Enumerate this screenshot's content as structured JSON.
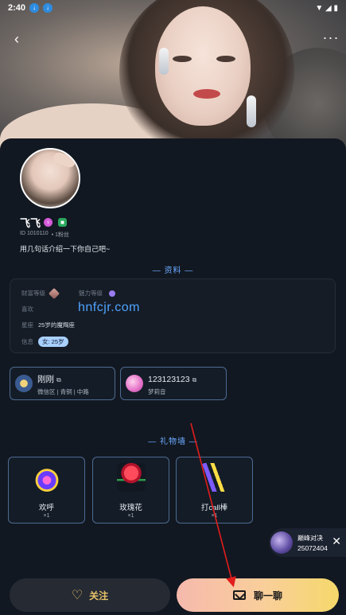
{
  "status_bar": {
    "time": "2:40",
    "badge1": "↓",
    "badge2": "↓",
    "right_icons": "▼ ◢ ▮"
  },
  "nav": {
    "back": "‹",
    "more": "···"
  },
  "profile": {
    "name": "飞飞",
    "gender_icon": "♀",
    "level_badge": "■",
    "id_text": "ID 1010110",
    "fans_text": "• 1粉丝",
    "bio": "用几句话介绍一下你自己吧~"
  },
  "sections": {
    "info": "— 资料 —",
    "gifts": "— 礼物墙 —"
  },
  "info": {
    "wealth_label": "财富等级",
    "charm_label": "魅力等级",
    "likes_label": "喜欢",
    "constellation_label": "星座",
    "constellation_value": "25岁的魔羯座",
    "info_label": "信息",
    "info_tag": "女: 25岁"
  },
  "watermark": "hnfcjr.com",
  "accounts": [
    {
      "name": "刚刚",
      "sub": "微信区 | 青铜 | 中路",
      "copy": "⧉"
    },
    {
      "name": "123123123",
      "sub": "梦莉音",
      "copy": "⧉"
    }
  ],
  "gifts": [
    {
      "name": "欢呼",
      "count": "×1"
    },
    {
      "name": "玫瑰花",
      "count": "×1"
    },
    {
      "name": "打call棒",
      "count": "×1"
    }
  ],
  "live_chip": {
    "title": "巅峰对决",
    "id": "25072404",
    "close": "✕"
  },
  "actions": {
    "follow_icon": "♡",
    "follow": "关注",
    "chat": "聊一聊"
  },
  "colors": {
    "accent_blue": "#6aa9ff",
    "gold": "#e8c36a",
    "card_bg": "#121821",
    "arrow": "#e11d1d"
  },
  "icons": [
    "back-icon",
    "more-icon",
    "heart-icon",
    "mail-icon",
    "copy-icon",
    "close-icon"
  ]
}
